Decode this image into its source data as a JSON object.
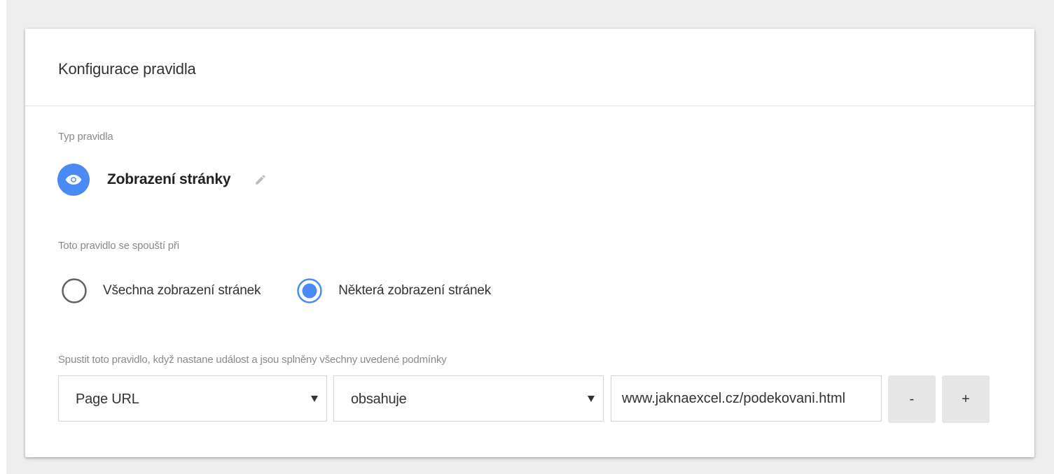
{
  "card": {
    "title": "Konfigurace pravidla"
  },
  "rule_type": {
    "label": "Typ pravidla",
    "name": "Zobrazení stránky",
    "icon": "eye-icon",
    "edit_icon": "pencil-icon",
    "accent_color": "#4a8af4"
  },
  "trigger": {
    "label": "Toto pravidlo se spouští při",
    "options": [
      {
        "label": "Všechna zobrazení stránek",
        "selected": false
      },
      {
        "label": "Některá zobrazení stránek",
        "selected": true
      }
    ]
  },
  "conditions": {
    "label": "Spustit toto pravidlo, když nastane událost a jsou splněny všechny uvedené podmínky",
    "rows": [
      {
        "variable": "Page URL",
        "operator": "obsahuje",
        "value": "www.jaknaexcel.cz/podekovani.html",
        "remove_label": "-",
        "add_label": "+"
      }
    ]
  }
}
